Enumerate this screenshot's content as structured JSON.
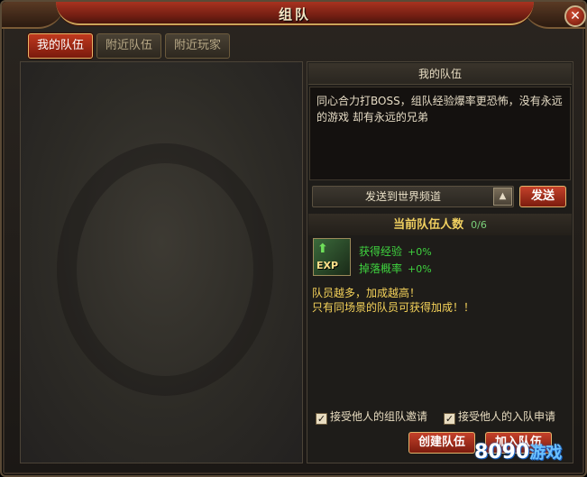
{
  "window": {
    "title": "组队"
  },
  "tabs": [
    {
      "label": "我的队伍",
      "active": true
    },
    {
      "label": "附近队伍",
      "active": false
    },
    {
      "label": "附近玩家",
      "active": false
    }
  ],
  "my_team": {
    "header": "我的队伍",
    "message_line1": "同心合力打BOSS，组队经验爆率更恐怖，没有永远",
    "message_line2": "的游戏 却有永远的兄弟",
    "channel": "发送到世界频道",
    "send_label": "发送"
  },
  "team_count": {
    "label": "当前队伍人数",
    "value": "0/6"
  },
  "bonus": {
    "icon_label": "EXP",
    "exp_label": "获得经验",
    "exp_value": "+0%",
    "drop_label": "掉落概率",
    "drop_value": "+0%"
  },
  "notes": {
    "line1": "队员越多，加成越高！",
    "line2": "只有同场景的队员可获得加成！！"
  },
  "options": {
    "accept_invite": {
      "label": "接受他人的组队邀请",
      "checked": true
    },
    "accept_apply": {
      "label": "接受他人的入队申请",
      "checked": true
    }
  },
  "buttons": {
    "create_team": "创建队伍",
    "join_team": "加入队伍"
  },
  "watermark": {
    "a": "8090",
    "b": "游戏"
  },
  "colors": {
    "accent_red": "#c0391e",
    "gold_border": "#e4b768",
    "green_text": "#3fd43f",
    "yellow_text": "#f6d35a"
  }
}
